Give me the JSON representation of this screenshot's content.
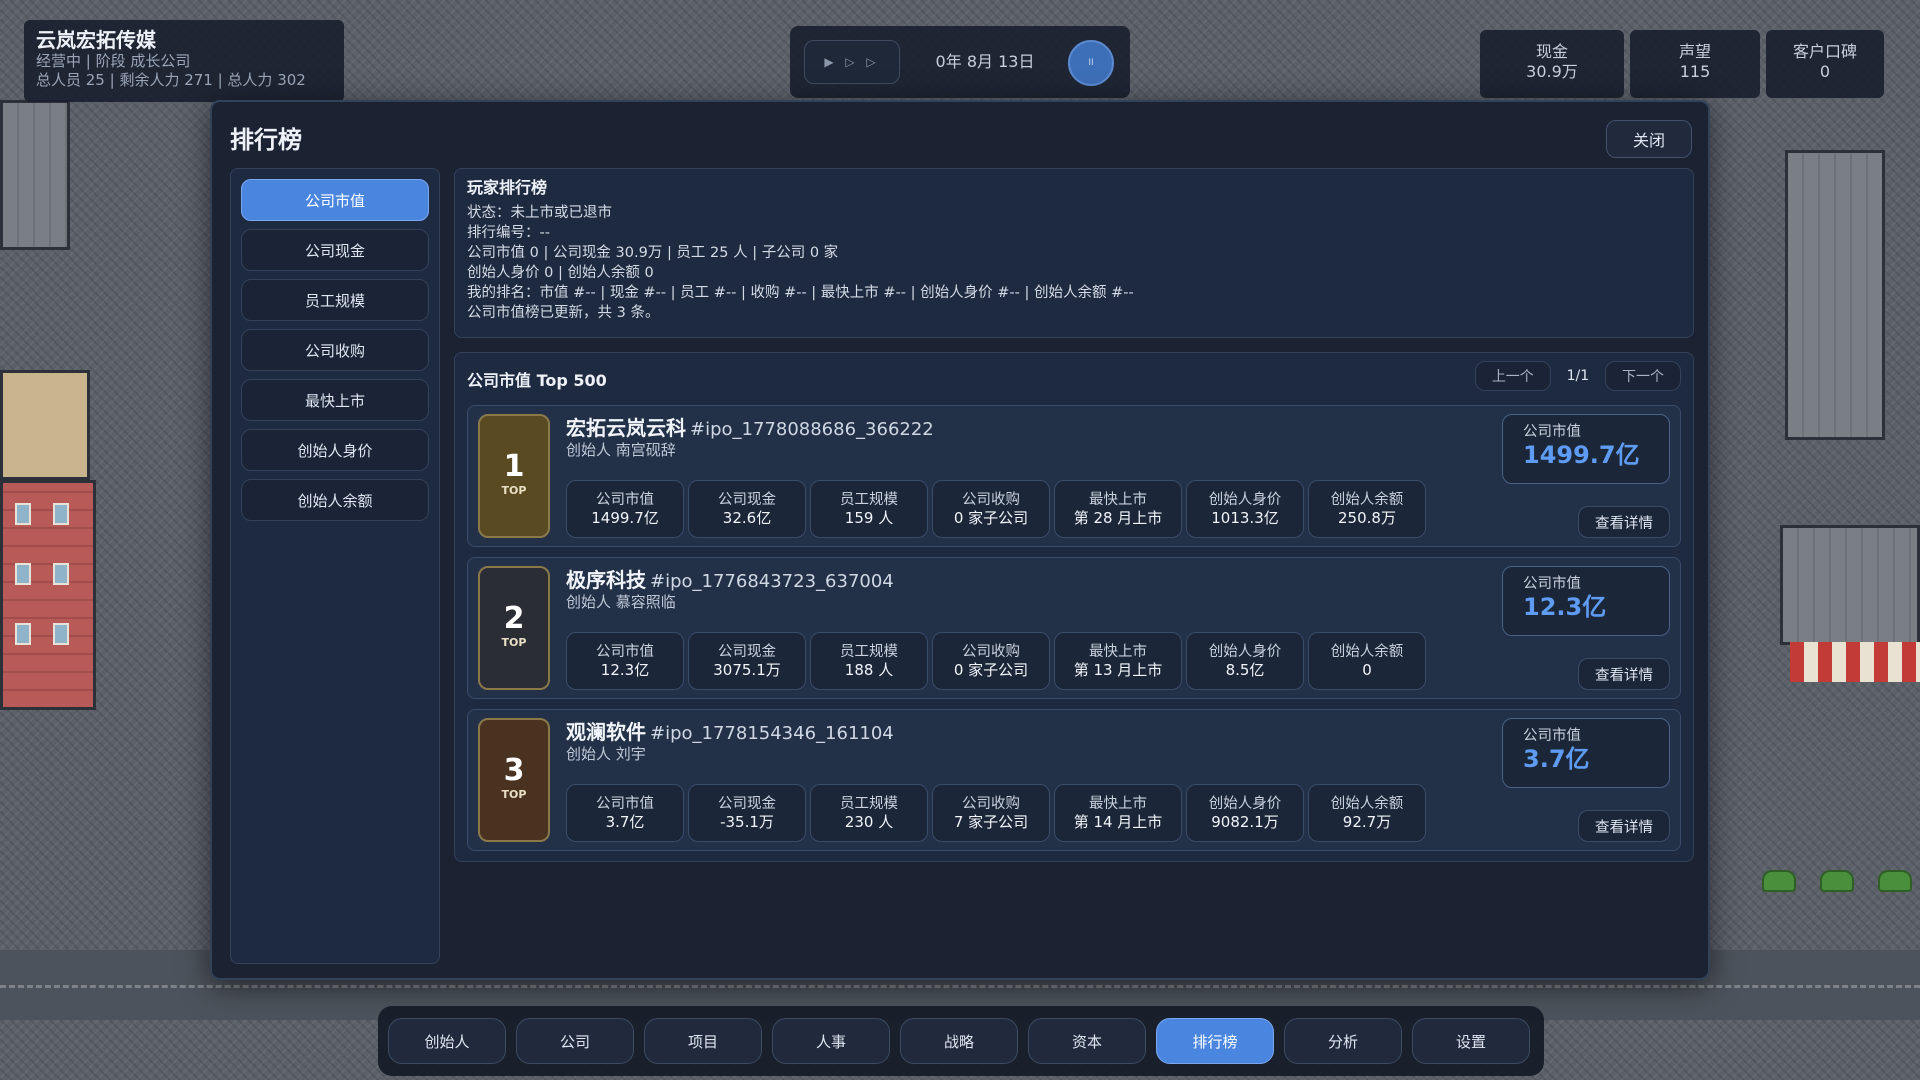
{
  "hud": {
    "company_name": "云岚宏拓传媒",
    "status_line": "经营中 | 阶段 成长公司",
    "staff_line": "总人员 25 | 剩余人力 271 | 总人力 302",
    "play_controls": "▶ ▷ ▷",
    "date": "0年 8月 13日",
    "speed_label": "II",
    "stats": [
      {
        "label": "现金",
        "value": "30.9万"
      },
      {
        "label": "声望",
        "value": "115"
      },
      {
        "label": "客户口碑",
        "value": "0"
      }
    ]
  },
  "modal": {
    "title": "排行榜",
    "close_label": "关闭"
  },
  "side_nav": {
    "items": [
      {
        "label": "公司市值",
        "active": true
      },
      {
        "label": "公司现金",
        "active": false
      },
      {
        "label": "员工规模",
        "active": false
      },
      {
        "label": "公司收购",
        "active": false
      },
      {
        "label": "最快上市",
        "active": false
      },
      {
        "label": "创始人身价",
        "active": false
      },
      {
        "label": "创始人余额",
        "active": false
      }
    ]
  },
  "player_panel": {
    "title": "玩家排行榜",
    "lines": [
      "状态：未上市或已退市",
      "排行编号：--",
      "公司市值 0 | 公司现金 30.9万 | 员工 25 人 | 子公司 0 家",
      "创始人身价 0 | 创始人余额 0",
      "我的排名：市值 #-- | 现金 #-- | 员工 #-- | 收购 #-- | 最快上市 #-- | 创始人身价 #-- | 创始人余额 #--",
      "公司市值榜已更新，共 3 条。"
    ]
  },
  "leaderboard": {
    "title": "公司市值 Top 500",
    "prev_label": "上一个",
    "page": "1/1",
    "next_label": "下一个",
    "top_label": "TOP",
    "mv_label": "公司市值",
    "detail_label": "查看详情",
    "metric_labels": [
      "公司市值",
      "公司现金",
      "员工规模",
      "公司收购",
      "最快上市",
      "创始人身价",
      "创始人余额"
    ],
    "entries": [
      {
        "rank": "1",
        "name": "宏拓云岚云科",
        "id": "#ipo_1778088686_366222",
        "founder": "创始人 南宫砚辞",
        "market_value": "1499.7亿",
        "metrics": [
          "1499.7亿",
          "32.6亿",
          "159 人",
          "0 家子公司",
          "第 28 月上市",
          "1013.3亿",
          "250.8万"
        ],
        "badge_color": "#5a4a22"
      },
      {
        "rank": "2",
        "name": "极序科技",
        "id": "#ipo_1776843723_637004",
        "founder": "创始人 慕容照临",
        "market_value": "12.3亿",
        "metrics": [
          "12.3亿",
          "3075.1万",
          "188 人",
          "0 家子公司",
          "第 13 月上市",
          "8.5亿",
          "0"
        ],
        "badge_color": "#2a2e34"
      },
      {
        "rank": "3",
        "name": "观澜软件",
        "id": "#ipo_1778154346_161104",
        "founder": "创始人 刘宇",
        "market_value": "3.7亿",
        "metrics": [
          "3.7亿",
          "-35.1万",
          "230 人",
          "7 家子公司",
          "第 14 月上市",
          "9082.1万",
          "92.7万"
        ],
        "badge_color": "#4a3220"
      }
    ]
  },
  "bottom_nav": {
    "items": [
      {
        "label": "创始人",
        "active": false
      },
      {
        "label": "公司",
        "active": false
      },
      {
        "label": "项目",
        "active": false
      },
      {
        "label": "人事",
        "active": false
      },
      {
        "label": "战略",
        "active": false
      },
      {
        "label": "资本",
        "active": false
      },
      {
        "label": "排行榜",
        "active": true
      },
      {
        "label": "分析",
        "active": false
      },
      {
        "label": "设置",
        "active": false
      }
    ]
  },
  "colors": {
    "accent": "#4a86e0",
    "panel": "#1e2a40",
    "value_blue": "#5d9cf2"
  }
}
